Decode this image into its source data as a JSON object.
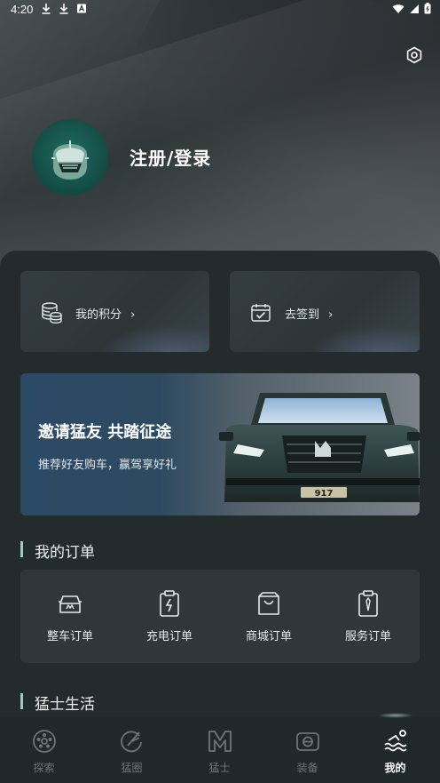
{
  "status_bar": {
    "time": "4:20",
    "left_icons": [
      "download-icon",
      "download-icon",
      "a-badge-icon"
    ],
    "right_icons": [
      "wifi-icon",
      "signal-icon",
      "battery-icon"
    ]
  },
  "header": {
    "settings_icon": "settings-hexagon-icon",
    "avatar_icon": "helmet-avatar-icon",
    "login_label": "注册/登录"
  },
  "quick_cards": [
    {
      "label": "我的积分",
      "icon": "coins-icon",
      "arrow": "›"
    },
    {
      "label": "去签到",
      "icon": "calendar-check-icon",
      "arrow": "›"
    }
  ],
  "banner": {
    "title": "邀请猛友 共踏征途",
    "subtitle": "推荐好友购车，赢驾享好礼",
    "plate": "917"
  },
  "orders_section": {
    "title": "我的订单",
    "items": [
      {
        "label": "整车订单",
        "icon": "car-order-icon"
      },
      {
        "label": "充电订单",
        "icon": "charging-order-icon"
      },
      {
        "label": "商城订单",
        "icon": "shopping-bag-icon"
      },
      {
        "label": "服务订单",
        "icon": "service-order-icon"
      }
    ]
  },
  "life_section": {
    "title": "猛士生活"
  },
  "tabbar": {
    "items": [
      {
        "label": "探索",
        "icon": "explore-wheel-icon",
        "active": false
      },
      {
        "label": "猛圈",
        "icon": "circle-feather-icon",
        "active": false
      },
      {
        "label": "猛士",
        "icon": "m-logo-icon",
        "active": false
      },
      {
        "label": "装备",
        "icon": "equipment-icon",
        "active": false
      },
      {
        "label": "我的",
        "icon": "profile-wave-icon",
        "active": true
      }
    ]
  },
  "colors": {
    "accent": "#8fd3c5",
    "panel": "#232b2d",
    "card": "#2f3739"
  }
}
